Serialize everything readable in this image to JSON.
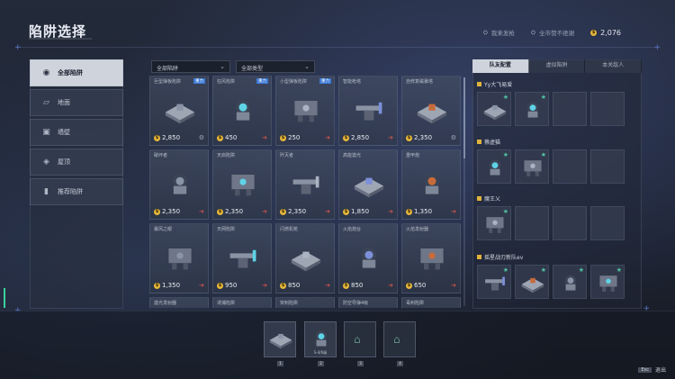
{
  "header": {
    "title": "陷阱选择",
    "links": [
      "我来发枪",
      "全市赞不绝谢"
    ],
    "money": "2,076"
  },
  "sidebar": {
    "items": [
      {
        "label": "全部陷阱",
        "icon": "all-traps-icon",
        "active": true
      },
      {
        "label": "地面",
        "icon": "floor-icon",
        "active": false
      },
      {
        "label": "墙壁",
        "icon": "wall-icon",
        "active": false
      },
      {
        "label": "屋顶",
        "icon": "ceiling-icon",
        "active": false
      },
      {
        "label": "推荐陷阱",
        "icon": "recommended-icon",
        "active": false
      }
    ]
  },
  "filters": {
    "trap_filter": "全部陷阱",
    "type_filter": "全部类型"
  },
  "traps": [
    {
      "name": "巨型弹板陷阱",
      "badge": "重力",
      "price": "2,850",
      "action": "info"
    },
    {
      "name": "狂风陷阱",
      "badge": "重力",
      "price": "450",
      "action": "buy"
    },
    {
      "name": "小型弹板陷阱",
      "badge": "重力",
      "price": "250",
      "action": "buy"
    },
    {
      "name": "智能枪塔",
      "badge": "",
      "price": "2,850",
      "action": "buy"
    },
    {
      "name": "自修复磁暴塔",
      "badge": "",
      "price": "2,350",
      "action": "info"
    },
    {
      "name": "破坏者",
      "badge": "",
      "price": "2,350",
      "action": "buy"
    },
    {
      "name": "天启陷阱",
      "badge": "",
      "price": "2,350",
      "action": "buy"
    },
    {
      "name": "歼灭者",
      "badge": "",
      "price": "2,350",
      "action": "buy"
    },
    {
      "name": "高能激光",
      "badge": "",
      "price": "1,850",
      "action": "buy"
    },
    {
      "name": "重甲炮",
      "badge": "",
      "price": "1,350",
      "action": "buy"
    },
    {
      "name": "暴风之眼",
      "badge": "",
      "price": "1,350",
      "action": "buy"
    },
    {
      "name": "天网陷阱",
      "badge": "",
      "price": "950",
      "action": "buy"
    },
    {
      "name": "闪燃机枪",
      "badge": "",
      "price": "850",
      "action": "buy"
    },
    {
      "name": "火焰炮台",
      "badge": "",
      "price": "850",
      "action": "buy"
    },
    {
      "name": "火焰发射器",
      "badge": "",
      "price": "650",
      "action": "buy"
    },
    {
      "name": "激光发射器",
      "badge": "",
      "price": "",
      "action": ""
    },
    {
      "name": "诱捕陷阱",
      "badge": "",
      "price": "",
      "action": ""
    },
    {
      "name": "突刺陷阱",
      "badge": "",
      "price": "",
      "action": ""
    },
    {
      "name": "防空导弹4级",
      "badge": "",
      "price": "",
      "action": ""
    },
    {
      "name": "毒刺陷阱",
      "badge": "",
      "price": "",
      "action": ""
    }
  ],
  "right_panel": {
    "tabs": [
      "队友配置",
      "虚拟陷阱",
      "本关敌人"
    ],
    "teams": [
      {
        "name": "Yy大飞易爱",
        "filled": 2
      },
      {
        "name": "蔡虚猫",
        "filled": 2
      },
      {
        "name": "魔王乂",
        "filled": 1
      },
      {
        "name": "摇星战刃新队ev",
        "filled": 4
      }
    ]
  },
  "bottom": {
    "slots": [
      {
        "label": "",
        "key": "1",
        "filled": true
      },
      {
        "label": "S-4/6级",
        "key": "2",
        "filled": true
      },
      {
        "label": "",
        "key": "3",
        "filled": false
      },
      {
        "label": "",
        "key": "4",
        "filled": false
      }
    ],
    "esc_key": "Esc",
    "esc_label": "退出"
  },
  "colors": {
    "accent": "#3d7bd6",
    "buy": "#d9534f",
    "coin": "#e6b73c",
    "active_tab": "#cfd4dc",
    "star": "#4fc3a1"
  }
}
